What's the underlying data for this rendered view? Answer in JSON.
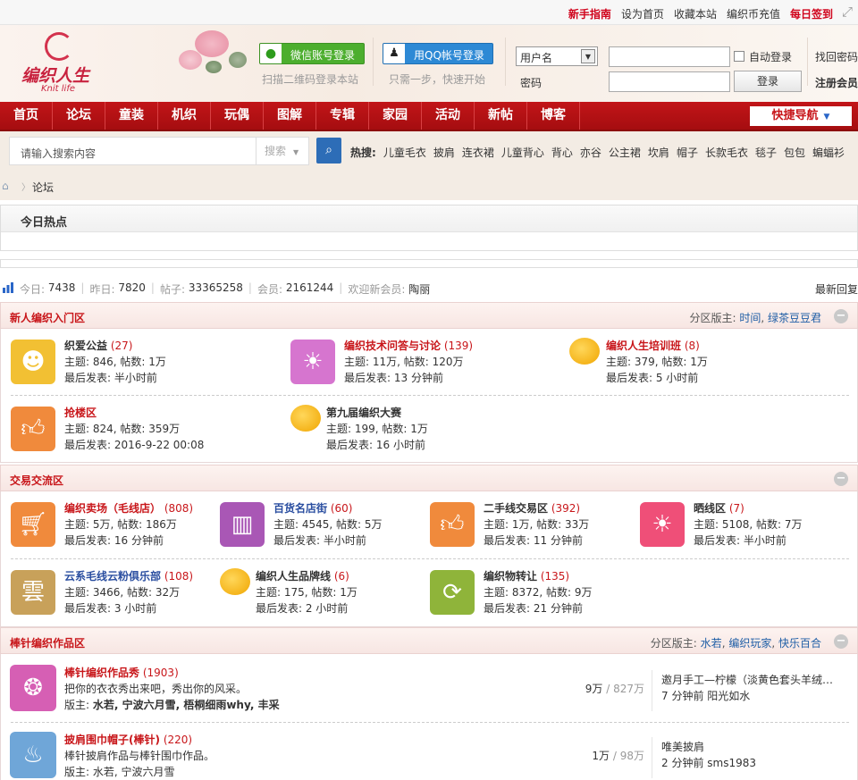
{
  "topbar": {
    "links": [
      "新手指南",
      "设为首页",
      "收藏本站",
      "编织币充值",
      "每日签到"
    ]
  },
  "header": {
    "logo_cn": "编织人生",
    "logo_en": "Knit life",
    "wechat_btn": "微信账号登录",
    "wechat_hint": "扫描二维码登录本站",
    "qq_btn": "用QQ帐号登录",
    "qq_hint": "只需一步，快速开始",
    "username_select": "用户名",
    "password_label": "密码",
    "auto_login": "自动登录",
    "login_btn": "登录",
    "find_password": "找回密码",
    "register": "注册会员"
  },
  "nav": {
    "items": [
      "首页",
      "论坛",
      "童装",
      "机织",
      "玩偶",
      "图解",
      "专辑",
      "家园",
      "活动",
      "新帖",
      "博客"
    ],
    "quick": "快捷导航"
  },
  "search": {
    "placeholder": "请输入搜索内容",
    "type": "搜索",
    "hot_label": "热搜:",
    "hot": [
      "儿童毛衣",
      "披肩",
      "连衣裙",
      "儿童背心",
      "背心",
      "亦谷",
      "公主裙",
      "坎肩",
      "帽子",
      "长款毛衣",
      "毯子",
      "包包",
      "蝙蝠衫"
    ]
  },
  "breadcrumb": {
    "current": "论坛"
  },
  "today_hot": {
    "title": "今日热点"
  },
  "stats": {
    "today_label": "今日:",
    "today": "7438",
    "yesterday_label": "昨日:",
    "yesterday": "7820",
    "posts_label": "帖子:",
    "posts": "33365258",
    "members_label": "会员:",
    "members": "2161244",
    "new_member_label": "欢迎新会员:",
    "new_member": "陶丽",
    "latest": "最新回复"
  },
  "sections": [
    {
      "title": "新人编织入门区",
      "mods_label": "分区版主:",
      "mods": [
        "时间",
        "绿茶豆豆君"
      ],
      "forums": [
        {
          "name": "织爱公益",
          "count": "(27)",
          "stats": "主题: 846, 帖数: 1万",
          "last": "最后发表: 半小时前"
        },
        {
          "name": "编织技术问答与讨论",
          "count": "(139)",
          "stats": "主题: 11万, 帖数: 120万",
          "last": "最后发表: 13 分钟前"
        },
        {
          "name": "编织人生培训班",
          "count": "(8)",
          "stats": "主题: 379, 帖数: 1万",
          "last": "最后发表: 5 小时前"
        },
        {
          "name": "抢楼区",
          "count": "",
          "stats": "主题: 824, 帖数: 359万",
          "last": "最后发表: 2016-9-22 00:08"
        },
        {
          "name": "第九届编织大赛",
          "count": "",
          "stats": "主题: 199, 帖数: 1万",
          "last": "最后发表: 16 小时前"
        }
      ]
    },
    {
      "title": "交易交流区",
      "forums": [
        {
          "name": "编织卖场（毛线店）",
          "count": "(808)",
          "stats": "主题: 5万, 帖数: 186万",
          "last": "最后发表: 16 分钟前"
        },
        {
          "name": "百货名店街",
          "count": "(60)",
          "stats": "主题: 4545, 帖数: 5万",
          "last": "最后发表: 半小时前"
        },
        {
          "name": "二手线交易区",
          "count": "(392)",
          "stats": "主题: 1万, 帖数: 33万",
          "last": "最后发表: 11 分钟前"
        },
        {
          "name": "晒线区",
          "count": "(7)",
          "stats": "主题: 5108, 帖数: 7万",
          "last": "最后发表: 半小时前"
        },
        {
          "name": "云系毛线云粉俱乐部",
          "count": "(108)",
          "stats": "主题: 3466, 帖数: 32万",
          "last": "最后发表: 3 小时前"
        },
        {
          "name": "编织人生品牌线",
          "count": "(6)",
          "stats": "主题: 175, 帖数: 1万",
          "last": "最后发表: 2 小时前"
        },
        {
          "name": "编织物转让",
          "count": "(135)",
          "stats": "主题: 8372, 帖数: 9万",
          "last": "最后发表: 21 分钟前"
        }
      ]
    },
    {
      "title": "棒针编织作品区",
      "mods_label": "分区版主:",
      "mods": [
        "水若",
        "编织玩家",
        "快乐百合"
      ],
      "rows": [
        {
          "name": "棒针编织作品秀",
          "count": "(1903)",
          "desc": "把你的衣衣秀出来吧，秀出你的风采。",
          "mods_label": "版主:",
          "mods": "水若, 宁波六月雪, 梧桐细雨why, 丰采",
          "threads": "9万",
          "posts": "827万",
          "last_title": "邀月手工—柠檬（淡黄色套头羊绒…",
          "last_meta": "7 分钟前 阳光如水"
        },
        {
          "name": "披肩围巾帽子(棒针)",
          "count": "(220)",
          "desc": "棒针披肩作品与棒针围巾作品。",
          "mods_label": "版主:",
          "mods": "水若, 宁波六月雪",
          "threads": "1万",
          "posts": "98万",
          "last_title": "唯美披肩",
          "last_meta": "2 分钟前 sms1983"
        }
      ]
    }
  ],
  "colors": {
    "brand_red": "#c8161a",
    "nav_red": "#b31114",
    "link_blue": "#1f5ea6"
  }
}
